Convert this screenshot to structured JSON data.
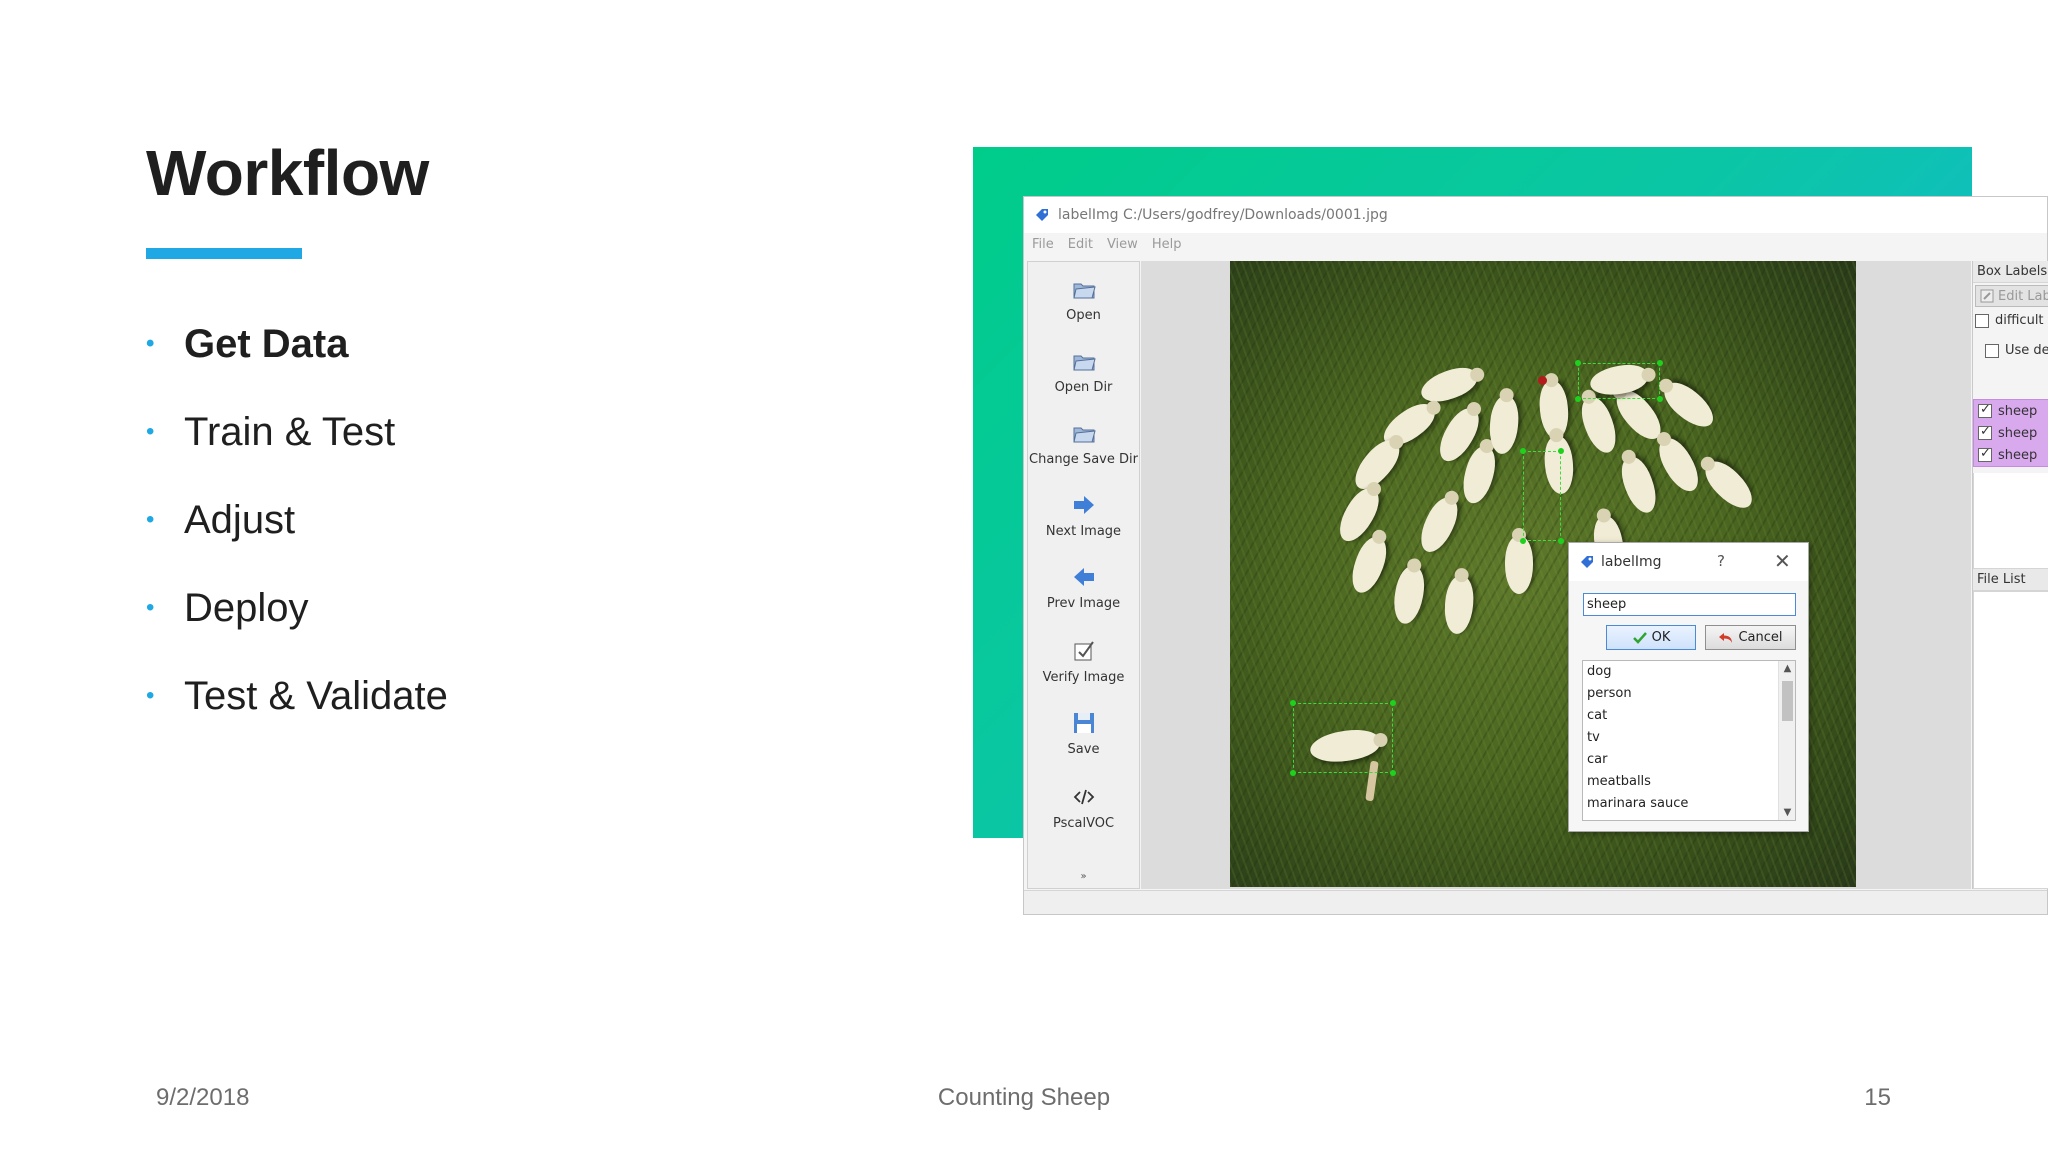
{
  "slide": {
    "title": "Workflow",
    "bullets": [
      {
        "label": "Get Data",
        "active": true
      },
      {
        "label": "Train & Test",
        "active": false
      },
      {
        "label": "Adjust",
        "active": false
      },
      {
        "label": "Deploy",
        "active": false
      },
      {
        "label": "Test & Validate",
        "active": false
      }
    ],
    "bullet_glyph": "•",
    "footer": {
      "date": "9/2/2018",
      "center": "Counting Sheep",
      "page": "15"
    },
    "colors": {
      "accent": "#1fa8e3",
      "gradient_start": "#00cc8a",
      "gradient_end": "#19b2e6"
    }
  },
  "app": {
    "title": "labelImg C:/Users/godfrey/Downloads/0001.jpg",
    "menu": [
      "File",
      "Edit",
      "View",
      "Help"
    ],
    "tools": [
      {
        "label": "Open",
        "icon": "folder-icon"
      },
      {
        "label": "Open Dir",
        "icon": "folder-icon"
      },
      {
        "label": "Change Save Dir",
        "icon": "folder-icon"
      },
      {
        "label": "Next Image",
        "icon": "arrow-right-icon"
      },
      {
        "label": "Prev Image",
        "icon": "arrow-left-icon"
      },
      {
        "label": "Verify Image",
        "icon": "checkbox-icon"
      },
      {
        "label": "Save",
        "icon": "floppy-icon"
      },
      {
        "label": "PscalVOC",
        "icon": "code-icon"
      }
    ],
    "tool_more_glyph": "»",
    "dock": {
      "box_labels_title": "Box Labels",
      "edit_label": "Edit Label",
      "difficult": "difficult",
      "use_default": "Use default label",
      "labels": [
        "sheep",
        "sheep",
        "sheep"
      ],
      "file_list_title": "File List",
      "label_highlight": "#d9a9ee"
    }
  },
  "dialog": {
    "title": "labelImg",
    "help_glyph": "?",
    "close_glyph": "✕",
    "input_value": "sheep",
    "ok_label": "OK",
    "cancel_label": "Cancel",
    "classes": [
      "dog",
      "person",
      "cat",
      "tv",
      "car",
      "meatballs",
      "marinara sauce"
    ],
    "scroll_up_glyph": "▲",
    "scroll_down_glyph": "▼"
  }
}
